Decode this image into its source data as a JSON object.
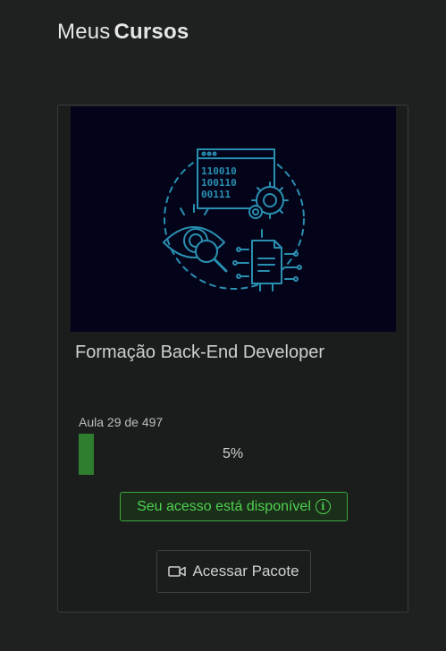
{
  "header": {
    "title_light": "Meus",
    "title_bold": "Cursos"
  },
  "course": {
    "title": "Formação Back-End Developer",
    "lesson_text": "Aula 29 de 497",
    "progress_percent": 5,
    "progress_label": "5%",
    "thumbnail_code_lines": [
      "110010",
      "100110",
      "00111"
    ],
    "status_label": "Seu acesso está disponível",
    "status_icon": "info-icon",
    "button_label": "Acessar Pacote",
    "button_icon": "video-camera-icon"
  },
  "colors": {
    "background": "#1f2121",
    "thumbnail_bg": "#03041a",
    "thumbnail_line": "#2a8fb0",
    "progress_fill": "#2f7d2f",
    "status_green": "#4fd14f"
  }
}
